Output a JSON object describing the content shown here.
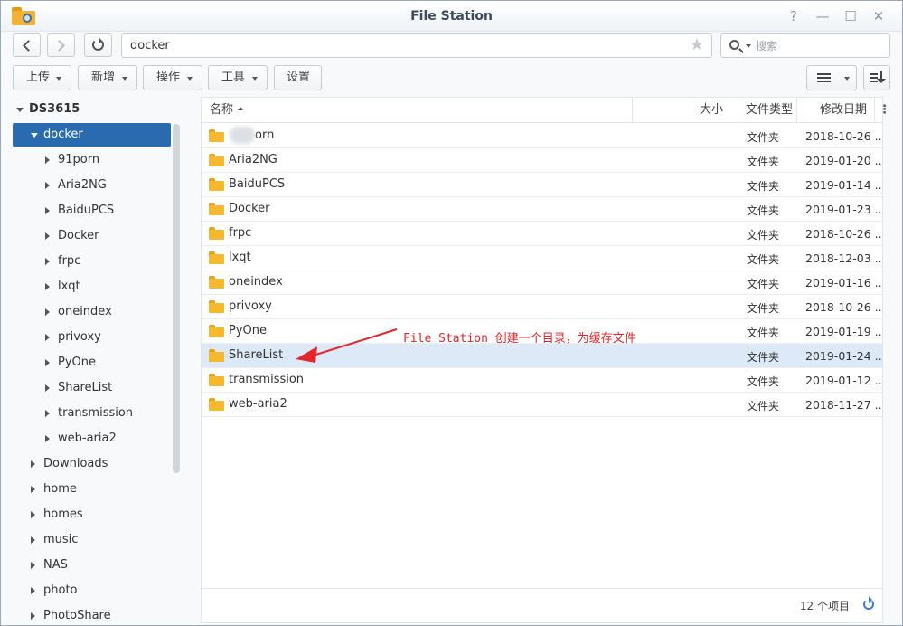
{
  "window": {
    "title": "File Station"
  },
  "nav": {
    "path": "docker",
    "search_placeholder": "搜索"
  },
  "toolbar": {
    "upload": "上传",
    "new": "新增",
    "action": "操作",
    "tools": "工具",
    "settings": "设置"
  },
  "tree": {
    "root": "DS3615",
    "selected": "docker",
    "children": [
      "91porn",
      "Aria2NG",
      "BaiduPCS",
      "Docker",
      "frpc",
      "lxqt",
      "oneindex",
      "privoxy",
      "PyOne",
      "ShareList",
      "transmission",
      "web-aria2"
    ],
    "others": [
      "Downloads",
      "home",
      "homes",
      "music",
      "NAS",
      "photo",
      "PhotoShare"
    ]
  },
  "columns": {
    "name": "名称",
    "size": "大小",
    "type": "文件类型",
    "date": "修改日期"
  },
  "files": [
    {
      "name": "orn",
      "type": "文件夹",
      "date": "2018-10-26 ..."
    },
    {
      "name": "Aria2NG",
      "type": "文件夹",
      "date": "2019-01-20 ..."
    },
    {
      "name": "BaiduPCS",
      "type": "文件夹",
      "date": "2019-01-14 ..."
    },
    {
      "name": "Docker",
      "type": "文件夹",
      "date": "2019-01-23 ..."
    },
    {
      "name": "frpc",
      "type": "文件夹",
      "date": "2018-10-26 ..."
    },
    {
      "name": "lxqt",
      "type": "文件夹",
      "date": "2018-12-03 ..."
    },
    {
      "name": "oneindex",
      "type": "文件夹",
      "date": "2019-01-16 ..."
    },
    {
      "name": "privoxy",
      "type": "文件夹",
      "date": "2018-10-26 ..."
    },
    {
      "name": "PyOne",
      "type": "文件夹",
      "date": "2019-01-19 ..."
    },
    {
      "name": "ShareList",
      "type": "文件夹",
      "date": "2019-01-24 ..."
    },
    {
      "name": "transmission",
      "type": "文件夹",
      "date": "2019-01-12 ..."
    },
    {
      "name": "web-aria2",
      "type": "文件夹",
      "date": "2018-11-27 ..."
    }
  ],
  "footer": {
    "count": "12 个项目"
  },
  "annotation": {
    "text": "File Station 创建一个目录，为缓存文件"
  },
  "colors": {
    "selected_tree": "#2a6bb0",
    "selected_row": "#dde9f7",
    "annotation": "#e2262b",
    "folder": "#f5b82e"
  }
}
